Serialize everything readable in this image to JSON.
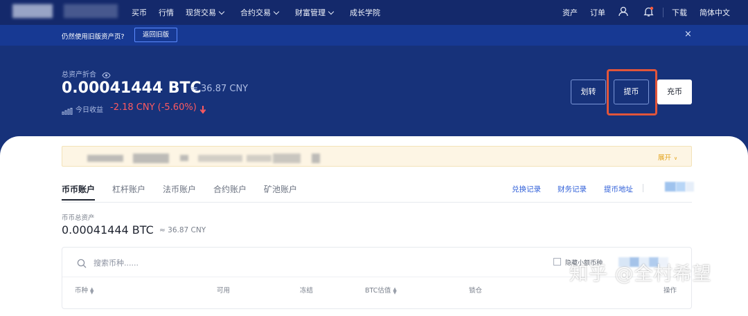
{
  "nav": {
    "items": [
      {
        "label": "买币",
        "dropdown": false
      },
      {
        "label": "行情",
        "dropdown": false
      },
      {
        "label": "现货交易",
        "dropdown": true
      },
      {
        "label": "合约交易",
        "dropdown": true
      },
      {
        "label": "财富管理",
        "dropdown": true
      },
      {
        "label": "成长学院",
        "dropdown": false
      }
    ],
    "right": {
      "assets": "资产",
      "orders": "订单",
      "download": "下载",
      "language": "简体中文"
    },
    "icons": {
      "user": "user-icon",
      "bell": "bell-icon"
    }
  },
  "notice": {
    "text": "仍然使用旧版资产页?",
    "back_button": "返回旧版",
    "close": "×"
  },
  "overview": {
    "label": "总资产折合",
    "btc": "0.00041444 BTC",
    "cny": "≈ 36.87 CNY",
    "today_label": "今日收益",
    "today_value": "-2.18 CNY (-5.60%)"
  },
  "actions": {
    "transfer": "划转",
    "withdraw": "提币",
    "deposit": "充币"
  },
  "alert": {
    "expand": "展开"
  },
  "tabs": [
    "币币账户",
    "杠杆账户",
    "法币账户",
    "合约账户",
    "矿池账户"
  ],
  "links": [
    "兑换记录",
    "财务记录",
    "提币地址"
  ],
  "spot": {
    "label": "币币总资产",
    "btc": "0.00041444 BTC",
    "cny": "≈ 36.87 CNY"
  },
  "search": {
    "placeholder": "搜索币种......"
  },
  "filter": {
    "hide_small": "隐藏小额币种"
  },
  "table": {
    "headers": [
      "币种",
      "可用",
      "冻结",
      "BTC估值",
      "锁仓",
      "操作"
    ]
  },
  "watermark": "知乎 @全村希望",
  "colors": {
    "hero": "#17327a",
    "accent_link": "#2f5fd8",
    "negative": "#ff5a5f",
    "highlight": "#e2553a",
    "expand": "#e3a21a"
  }
}
